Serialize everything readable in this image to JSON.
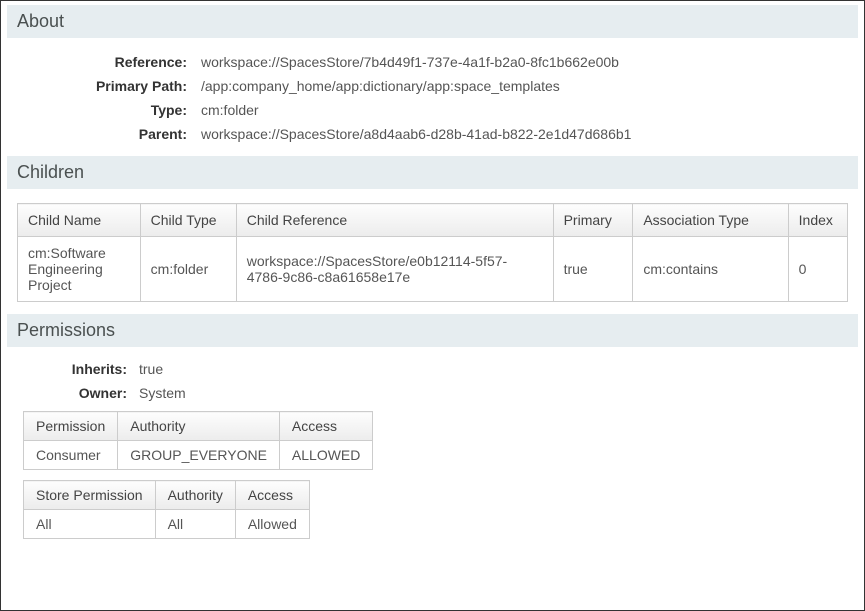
{
  "about": {
    "title": "About",
    "labels": {
      "reference": "Reference:",
      "primary_path": "Primary Path:",
      "type": "Type:",
      "parent": "Parent:"
    },
    "values": {
      "reference": "workspace://SpacesStore/7b4d49f1-737e-4a1f-b2a0-8fc1b662e00b",
      "primary_path": "/app:company_home/app:dictionary/app:space_templates",
      "type": "cm:folder",
      "parent": "workspace://SpacesStore/a8d4aab6-d28b-41ad-b822-2e1d47d686b1"
    }
  },
  "children": {
    "title": "Children",
    "headers": {
      "child_name": "Child Name",
      "child_type": "Child Type",
      "child_reference": "Child Reference",
      "primary": "Primary",
      "association_type": "Association Type",
      "index": "Index"
    },
    "rows": [
      {
        "child_name": "cm:Software Engineering Project",
        "child_type": "cm:folder",
        "child_reference": "workspace://SpacesStore/e0b12114-5f57-4786-9c86-c8a61658e17e",
        "primary": "true",
        "association_type": "cm:contains",
        "index": "0"
      }
    ]
  },
  "permissions": {
    "title": "Permissions",
    "labels": {
      "inherits": "Inherits:",
      "owner": "Owner:"
    },
    "values": {
      "inherits": "true",
      "owner": "System"
    },
    "perm_headers": {
      "permission": "Permission",
      "authority": "Authority",
      "access": "Access"
    },
    "perm_rows": [
      {
        "permission": "Consumer",
        "authority": "GROUP_EVERYONE",
        "access": "ALLOWED"
      }
    ],
    "store_headers": {
      "store_permission": "Store Permission",
      "authority": "Authority",
      "access": "Access"
    },
    "store_rows": [
      {
        "store_permission": "All",
        "authority": "All",
        "access": "Allowed"
      }
    ]
  }
}
